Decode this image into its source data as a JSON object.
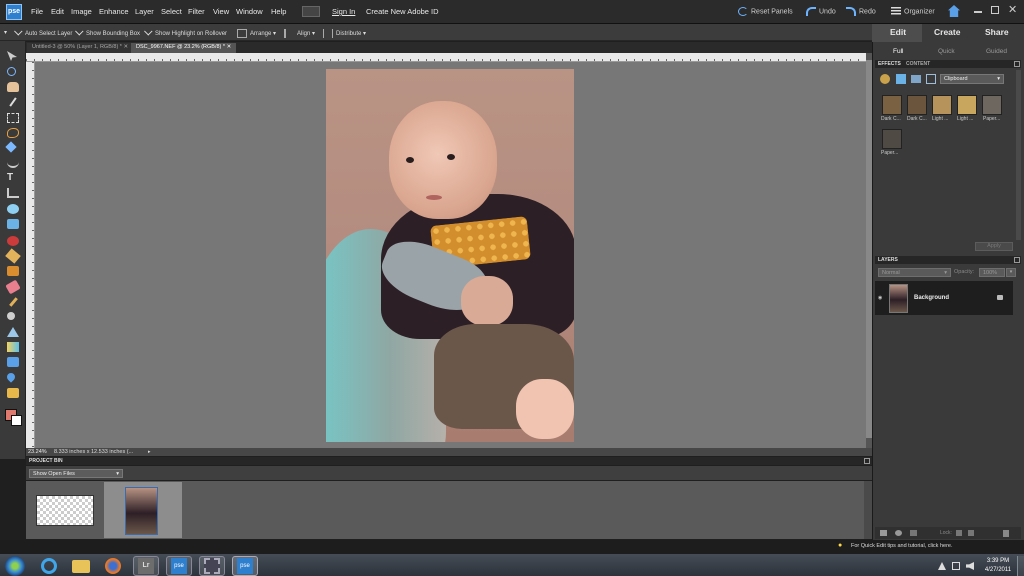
{
  "app": {
    "logo_text": "pse",
    "menus": [
      "File",
      "Edit",
      "Image",
      "Enhance",
      "Layer",
      "Select",
      "Filter",
      "View",
      "Window",
      "Help"
    ],
    "sign_in": "Sign In",
    "create_id": "Create New Adobe ID",
    "reset_panels": "Reset Panels",
    "undo": "Undo",
    "redo": "Redo",
    "organizer": "Organizer"
  },
  "options": {
    "auto_select": "Auto Select Layer",
    "bounding_box": "Show Bounding Box",
    "highlight": "Show Highlight on Rollover",
    "arrange": "Arrange",
    "align": "Align",
    "distribute": "Distribute"
  },
  "doc_tabs": [
    {
      "label": "Untitled-3 @ 50% (Layer 1, RGB/8) *"
    },
    {
      "label": "DSC_9967.NEF @ 23.2% (RGB/8) *"
    }
  ],
  "status": {
    "zoom": "23.24%",
    "dims": "8.333 inches x 12.533 inches (..."
  },
  "project_bin": {
    "title": "PROJECT BIN",
    "show": "Show Open Files"
  },
  "right_panel": {
    "modes": [
      "Edit",
      "Create",
      "Share"
    ],
    "sub_modes": [
      "Full",
      "Quick",
      "Guided"
    ],
    "effects_tab": "EFFECTS",
    "content_tab": "CONTENT",
    "category": "Clipboard",
    "effects": [
      "Dark C...",
      "Dark C...",
      "Light ...",
      "Light ...",
      "Paper...",
      "Paper..."
    ],
    "apply": "Apply",
    "layers_tab": "LAYERS",
    "blend_mode": "Normal",
    "opacity_label": "Opacity:",
    "opacity_value": "100%",
    "layer_name": "Background",
    "lock_label": "Lock:"
  },
  "taskbar": {
    "tip": "For Quick Edit tips and tutorial, click here.",
    "time": "3:39 PM",
    "date": "4/27/2011"
  },
  "colors": {
    "foreground": "#e07a6f",
    "background": "#ffffff",
    "accent": "#2f7fcf"
  }
}
